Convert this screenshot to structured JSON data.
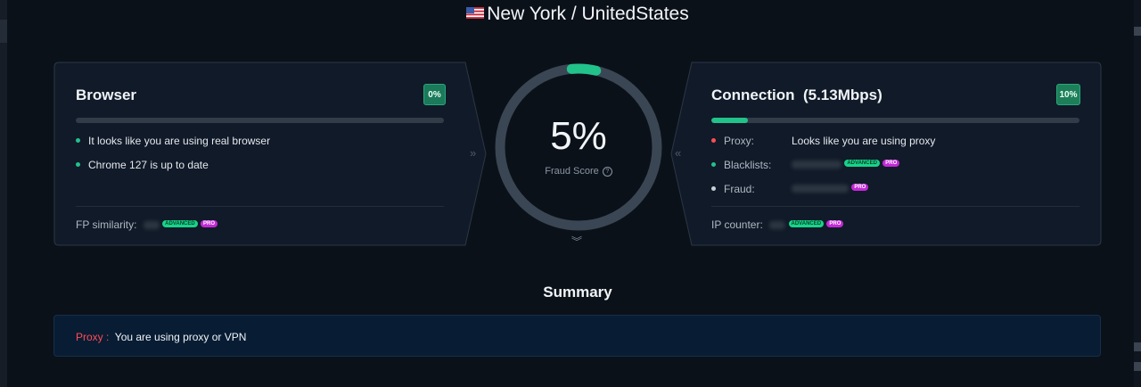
{
  "location": {
    "flag": "us-flag-icon",
    "text": "New York / UnitedStates"
  },
  "browser": {
    "title": "Browser",
    "badge": "0%",
    "progress": 0,
    "items": [
      {
        "text": "It looks like you are using real browser",
        "status": "ok"
      },
      {
        "text": "Chrome 127 is up to date",
        "status": "ok"
      }
    ],
    "fp_label": "FP similarity:",
    "advanced_tag": "ADVANCED",
    "pro_tag": "PRO"
  },
  "score": {
    "value": "5%",
    "label": "Fraud Score",
    "help_icon": "question-circle-icon",
    "fraction": 0.05
  },
  "connection": {
    "title": "Connection",
    "speed": "(5.13Mbps)",
    "badge": "10%",
    "progress": 0.1,
    "proxy_label": "Proxy:",
    "proxy_value": "Looks like you are using proxy",
    "blacklists_label": "Blacklists:",
    "fraud_label": "Fraud:",
    "ip_label": "IP counter:",
    "advanced_tag": "ADVANCED",
    "pro_tag": "PRO"
  },
  "summary": {
    "title": "Summary",
    "label": "Proxy :",
    "text": "You are using proxy or VPN"
  },
  "colors": {
    "accent": "#22c28b",
    "danger": "#ff4d57",
    "pro": "#c329d8",
    "advanced": "#18d48a",
    "card_bg": "#111a28"
  }
}
